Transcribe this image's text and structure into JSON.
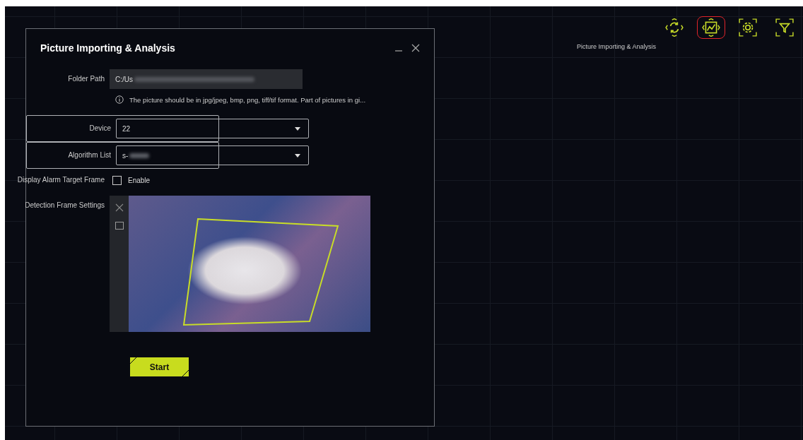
{
  "toolbar": {
    "items": [
      {
        "kind": "refresh",
        "selected": false
      },
      {
        "kind": "chart",
        "selected": true
      },
      {
        "kind": "settings",
        "selected": false
      },
      {
        "kind": "filter",
        "selected": false
      }
    ],
    "caption": "Picture Importing & Analysis"
  },
  "dialog": {
    "title": "Picture Importing & Analysis",
    "fields": [
      {
        "kind": "path",
        "label": "Folder Path",
        "value": "C:/Us",
        "hint": "The picture should be in jpg/jpeg, bmp, png, tiff/tif format. Part of pictures in gi..."
      },
      {
        "kind": "select",
        "label": "Device",
        "value": "22"
      },
      {
        "kind": "select",
        "label": "Algorithm List",
        "value": "s-"
      },
      {
        "kind": "checkbox",
        "label": "Display Alarm Target Frame",
        "option": "Enable",
        "checked": false
      },
      {
        "kind": "picture",
        "label": "Detection Frame Settings"
      }
    ],
    "start_button": "Start"
  }
}
